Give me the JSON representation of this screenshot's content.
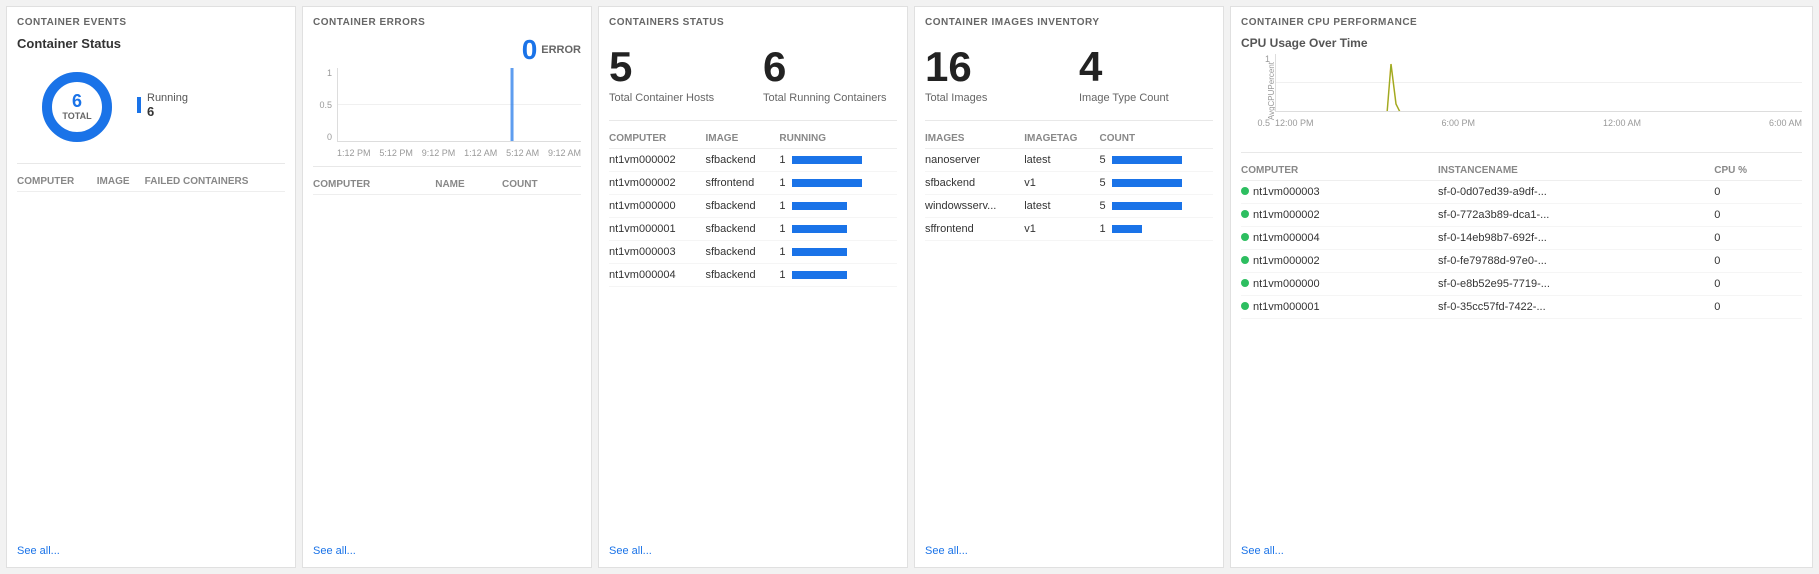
{
  "panels": {
    "events": {
      "title": "CONTAINER EVENTS",
      "subtitle": "Container Status",
      "donut": {
        "total": 6,
        "total_label": "TOTAL",
        "segments": [
          {
            "label": "Running",
            "value": 6,
            "color": "#1a73e8"
          }
        ]
      },
      "legend": [
        {
          "label": "Running",
          "value": "6",
          "color": "#1a73e8"
        }
      ],
      "table": {
        "columns": [
          "COMPUTER",
          "IMAGE",
          "FAILED CONTAINERS"
        ],
        "rows": []
      },
      "see_all": "See all..."
    },
    "errors": {
      "title": "CONTAINER ERRORS",
      "error_count": "0",
      "error_label": "ERROR",
      "y_labels": [
        "1",
        "0.5",
        "0"
      ],
      "x_labels": [
        "1:12 PM",
        "5:12 PM",
        "9:12 PM",
        "1:12 AM",
        "5:12 AM",
        "9:12 AM"
      ],
      "table": {
        "columns": [
          "COMPUTER",
          "NAME",
          "COUNT"
        ],
        "rows": []
      },
      "see_all": "See all..."
    },
    "containers_status": {
      "title": "CONTAINERS STATUS",
      "big_numbers": [
        {
          "value": "5",
          "label": "Total Container Hosts"
        },
        {
          "value": "6",
          "label": "Total Running Containers"
        }
      ],
      "table": {
        "columns": [
          "COMPUTER",
          "IMAGE",
          "RUNNING"
        ],
        "rows": [
          {
            "computer": "nt1vm000002",
            "image": "sfbackend",
            "running": "1",
            "bar": "lg"
          },
          {
            "computer": "nt1vm000002",
            "image": "sffrontend",
            "running": "1",
            "bar": "lg"
          },
          {
            "computer": "nt1vm000000",
            "image": "sfbackend",
            "running": "1",
            "bar": "md"
          },
          {
            "computer": "nt1vm000001",
            "image": "sfbackend",
            "running": "1",
            "bar": "md"
          },
          {
            "computer": "nt1vm000003",
            "image": "sfbackend",
            "running": "1",
            "bar": "md"
          },
          {
            "computer": "nt1vm000004",
            "image": "sfbackend",
            "running": "1",
            "bar": "md"
          }
        ]
      },
      "see_all": "See all..."
    },
    "images": {
      "title": "CONTAINER IMAGES INVENTORY",
      "big_numbers": [
        {
          "value": "16",
          "label": "Total Images"
        },
        {
          "value": "4",
          "label": "Image Type Count"
        }
      ],
      "table": {
        "columns": [
          "IMAGES",
          "IMAGETAG",
          "COUNT"
        ],
        "rows": [
          {
            "image": "nanoserver",
            "tag": "latest",
            "count": "5",
            "bar": "lg"
          },
          {
            "image": "sfbackend",
            "tag": "v1",
            "count": "5",
            "bar": "lg"
          },
          {
            "image": "windowsserv...",
            "tag": "latest",
            "count": "5",
            "bar": "lg"
          },
          {
            "image": "sffrontend",
            "tag": "v1",
            "count": "1",
            "bar": "sm"
          }
        ]
      },
      "see_all": "See all..."
    },
    "cpu": {
      "title": "CONTAINER CPU PERFORMANCE",
      "chart_title": "CPU Usage Over Time",
      "y_labels": [
        "1",
        "0.5"
      ],
      "x_labels": [
        "12:00 PM",
        "6:00 PM",
        "12:00 AM",
        "6:00 AM"
      ],
      "y_axis_label": "AvgCPUPercent",
      "table": {
        "columns": [
          "COMPUTER",
          "INSTANCENAME",
          "CPU %"
        ],
        "rows": [
          {
            "computer": "nt1vm000003",
            "instance": "sf-0-0d07ed39-a9df-...",
            "cpu": "0",
            "dot": true
          },
          {
            "computer": "nt1vm000002",
            "instance": "sf-0-772a3b89-dca1-...",
            "cpu": "0",
            "dot": true
          },
          {
            "computer": "nt1vm000004",
            "instance": "sf-0-14eb98b7-692f-...",
            "cpu": "0",
            "dot": true
          },
          {
            "computer": "nt1vm000002",
            "instance": "sf-0-fe79788d-97e0-...",
            "cpu": "0",
            "dot": true
          },
          {
            "computer": "nt1vm000000",
            "instance": "sf-0-e8b52e95-7719-...",
            "cpu": "0",
            "dot": true
          },
          {
            "computer": "nt1vm000001",
            "instance": "sf-0-35cc57fd-7422-...",
            "cpu": "0",
            "dot": true
          }
        ]
      },
      "see_all": "See all..."
    }
  }
}
